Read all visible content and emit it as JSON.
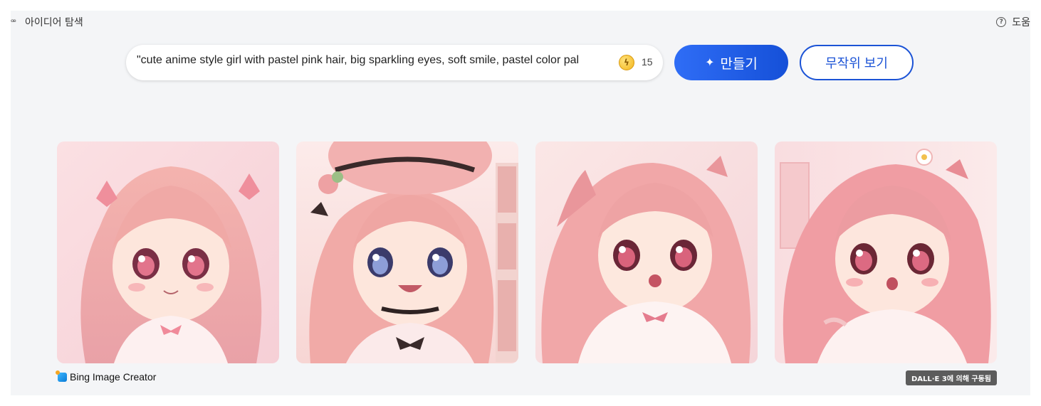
{
  "nav": {
    "left_icon": "bookmark-icon",
    "left_label": "아이디어 탐색",
    "right_icon": "help-icon",
    "right_label": "도움"
  },
  "search": {
    "value": "\"cute anime style girl with pastel pink hair, big sparkling eyes, soft smile, pastel color pal",
    "coin_icon": "boost-coin-icon",
    "coin_count": "15"
  },
  "buttons": {
    "create_label": "만들기",
    "create_icon": "image-sparkle-icon",
    "random_label": "무작위 보기"
  },
  "gallery": {
    "images": [
      {
        "name": "generated-image-1"
      },
      {
        "name": "generated-image-2"
      },
      {
        "name": "generated-image-3"
      },
      {
        "name": "generated-image-4"
      }
    ]
  },
  "footer": {
    "brand_label": "Bing Image Creator",
    "powered_label": "DALL·E 3에 의해 구동됨"
  },
  "colors": {
    "primary_blue": "#1b53d6",
    "page_bg": "#f4f5f7"
  }
}
